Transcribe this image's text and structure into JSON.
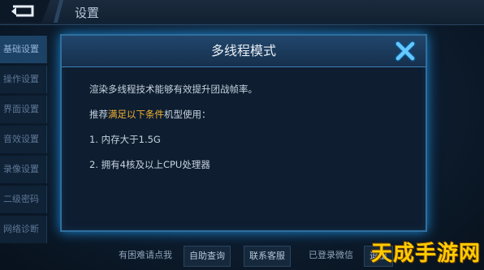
{
  "topbar": {
    "title": "设置"
  },
  "sidebar": {
    "items": [
      {
        "label": "基础设置",
        "active": true
      },
      {
        "label": "操作设置",
        "active": false
      },
      {
        "label": "界面设置",
        "active": false
      },
      {
        "label": "音效设置",
        "active": false
      },
      {
        "label": "录像设置",
        "active": false
      },
      {
        "label": "二级密码",
        "active": false
      },
      {
        "label": "网络诊断",
        "active": false
      }
    ]
  },
  "bottom_bar": {
    "help_text": "有困难请点我",
    "self_query": "自助查询",
    "contact_service": "联系客服",
    "logged_in": "已登录微信",
    "logout": "退出"
  },
  "dialog": {
    "title": "多线程模式",
    "line1": "渲染多线程技术能够有效提升团战帧率。",
    "line2_prefix": "推荐",
    "line2_highlight": "满足以下条件",
    "line2_suffix": "机型使用：",
    "line3": "1. 内存大于1.5G",
    "line4": "2. 拥有4核及以上CPU处理器"
  },
  "watermark": {
    "text": "天成手游网"
  },
  "colors": {
    "highlight": "#f2b233",
    "border_glow": "#1a86d0"
  }
}
